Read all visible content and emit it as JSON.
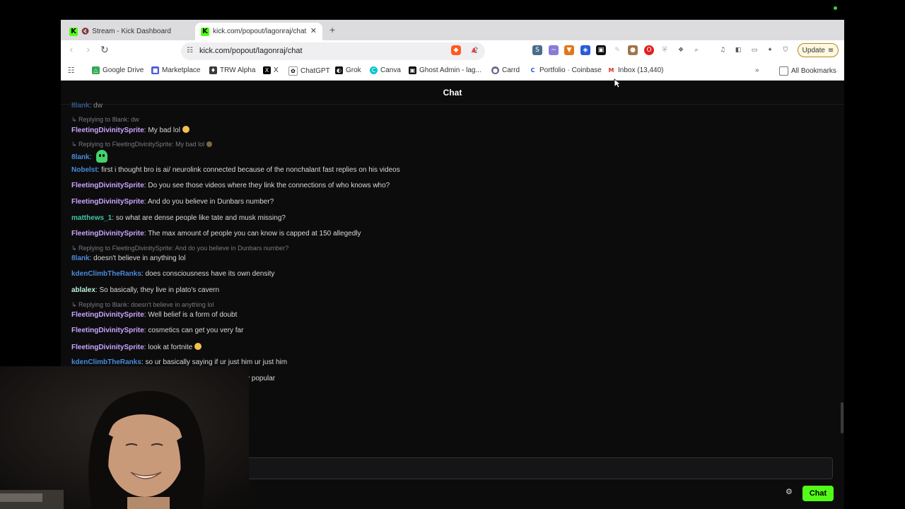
{
  "browser": {
    "tabs": [
      {
        "label": "Stream - Kick Dashboard",
        "active": false,
        "muted": true
      },
      {
        "label": "kick.com/popout/lagonraj/chat",
        "active": true
      }
    ],
    "url": "kick.com/popout/lagonraj/chat",
    "update_label": "Update",
    "bookmarks": [
      {
        "label": "Google Drive",
        "icon": "google-drive-icon"
      },
      {
        "label": "Marketplace",
        "icon": "marketplace-icon"
      },
      {
        "label": "TRW Alpha",
        "icon": "trw-icon"
      },
      {
        "label": "X",
        "icon": "x-icon"
      },
      {
        "label": "ChatGPT",
        "icon": "chatgpt-icon"
      },
      {
        "label": "Grok",
        "icon": "grok-icon"
      },
      {
        "label": "Canva",
        "icon": "canva-icon"
      },
      {
        "label": "Ghost Admin - lag...",
        "icon": "ghost-icon"
      },
      {
        "label": "Carrd",
        "icon": "carrd-icon"
      },
      {
        "label": "Portfolio · Coinbase",
        "icon": "coinbase-icon"
      },
      {
        "label": "Inbox (13,440)",
        "icon": "gmail-icon"
      }
    ],
    "all_bookmarks_label": "All Bookmarks",
    "brave_badge": "1"
  },
  "chat": {
    "header": "Chat",
    "messages": [
      {
        "reply_to": "Replying to 8lank: dw",
        "user": "FleetingDivinitySprite",
        "color": "purple",
        "text": "My bad lol ",
        "emote": "laugh"
      },
      {
        "reply_to": "Replying to FleetingDivinitySprite: My bad lol",
        "user": "8lank",
        "color": "blue",
        "text": "",
        "emote": "ghost"
      },
      {
        "user": "Nobelst",
        "color": "blue",
        "text": "first i thought bro is ai/ neurolink connected because of the nonchalant fast replies on his videos"
      },
      {
        "user": "FleetingDivinitySprite",
        "color": "purple",
        "text": "Do you see those videos where they link the connections of who knows who?"
      },
      {
        "user": "FleetingDivinitySprite",
        "color": "purple",
        "text": "And do you believe in Dunbars number?"
      },
      {
        "user": "matthews_1",
        "color": "teal",
        "text": "so what are dense people like tate and musk missing?"
      },
      {
        "user": "FleetingDivinitySprite",
        "color": "purple",
        "text": "The max amount of people you can know is capped at 150 allegedly"
      },
      {
        "reply_to": "Replying to FleetingDivinitySprite: And do you believe in Dunbars number?",
        "user": "8lank",
        "color": "blue",
        "text": "doesn't believe in anything lol"
      },
      {
        "user": "kdenClimbTheRanks",
        "color": "blue",
        "text": "does consciousness have its own density"
      },
      {
        "user": "ablalex",
        "color": "mint",
        "text": "So basically, they live in plato's cavern"
      },
      {
        "reply_to": "Replying to 8lank: doesn't believe in anything lol",
        "user": "FleetingDivinitySprite",
        "color": "purple",
        "text": "Well belief is a form of doubt"
      },
      {
        "user": "FleetingDivinitySprite",
        "color": "purple",
        "text": "cosmetics can get you very far"
      },
      {
        "user": "FleetingDivinitySprite",
        "color": "purple",
        "text": "look at fortnite ",
        "emote": "laugh"
      },
      {
        "user": "kdenClimbTheRanks",
        "color": "blue",
        "text": "so ur basically saying if ur just him ur just him"
      },
      {
        "user": "",
        "color": "blue",
        "text": "y popular"
      }
    ],
    "input_placeholder": "",
    "send_label": "Chat"
  }
}
